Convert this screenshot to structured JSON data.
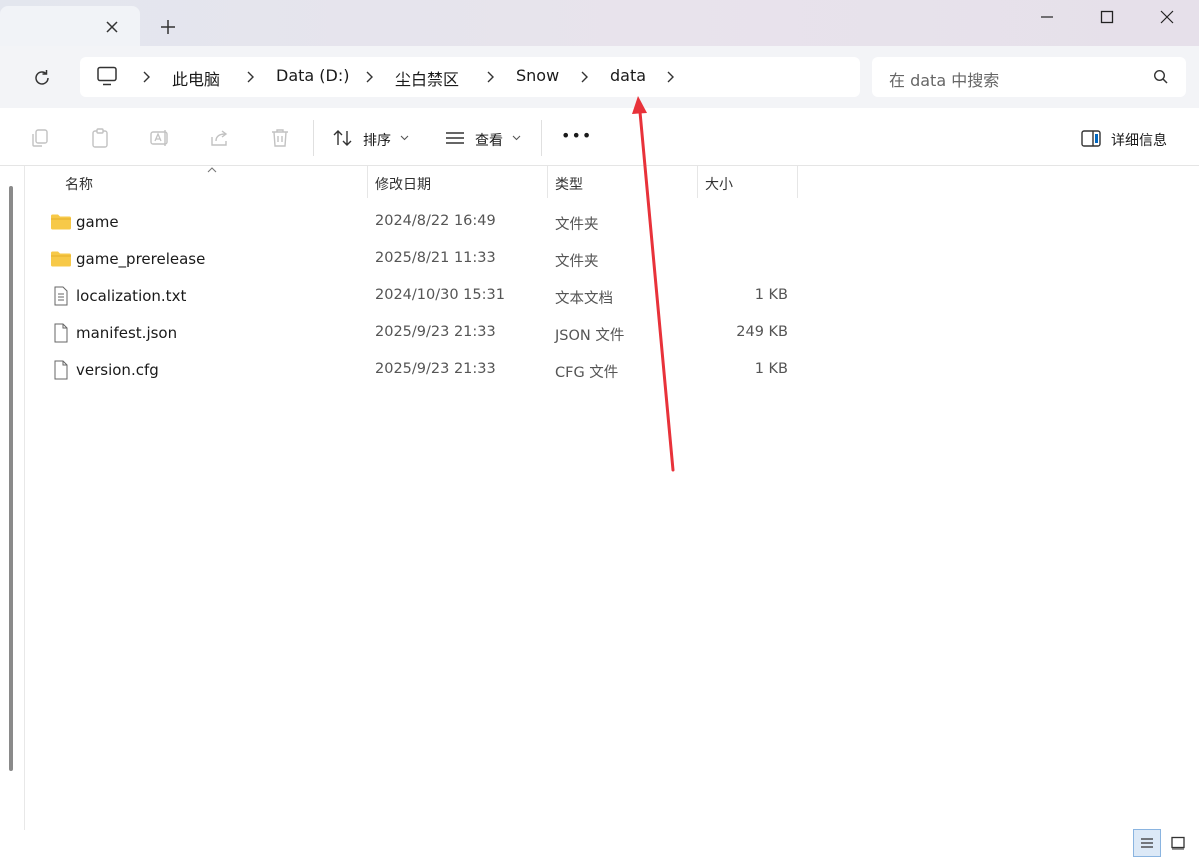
{
  "window": {
    "tab_close_icon": "close-icon",
    "new_tab_icon": "plus-icon",
    "controls": [
      "minimize-icon",
      "maximize-icon",
      "close-icon"
    ]
  },
  "address": {
    "crumbs": [
      "此电脑",
      "Data (D:)",
      "尘白禁区",
      "Snow",
      "data"
    ],
    "search_placeholder": "在 data 中搜索"
  },
  "toolbar": {
    "sort_label": "排序",
    "view_label": "查看",
    "more_label": "•••",
    "details_label": "详细信息"
  },
  "columns": {
    "name": "名称",
    "date": "修改日期",
    "type": "类型",
    "size": "大小"
  },
  "files": [
    {
      "name": "game",
      "date": "2024/8/22 16:49",
      "type": "文件夹",
      "size": "",
      "icon": "folder-icon"
    },
    {
      "name": "game_prerelease",
      "date": "2025/8/21 11:33",
      "type": "文件夹",
      "size": "",
      "icon": "folder-icon"
    },
    {
      "name": "localization.txt",
      "date": "2024/10/30 15:31",
      "type": "文本文档",
      "size": "1 KB",
      "icon": "text-file-icon"
    },
    {
      "name": "manifest.json",
      "date": "2025/9/23 21:33",
      "type": "JSON 文件",
      "size": "249 KB",
      "icon": "file-icon"
    },
    {
      "name": "version.cfg",
      "date": "2025/9/23 21:33",
      "type": "CFG 文件",
      "size": "1 KB",
      "icon": "file-icon"
    }
  ],
  "colors": {
    "folder": "#f7c948",
    "annotation_arrow": "#e8323a",
    "accent": "#0067c0"
  }
}
